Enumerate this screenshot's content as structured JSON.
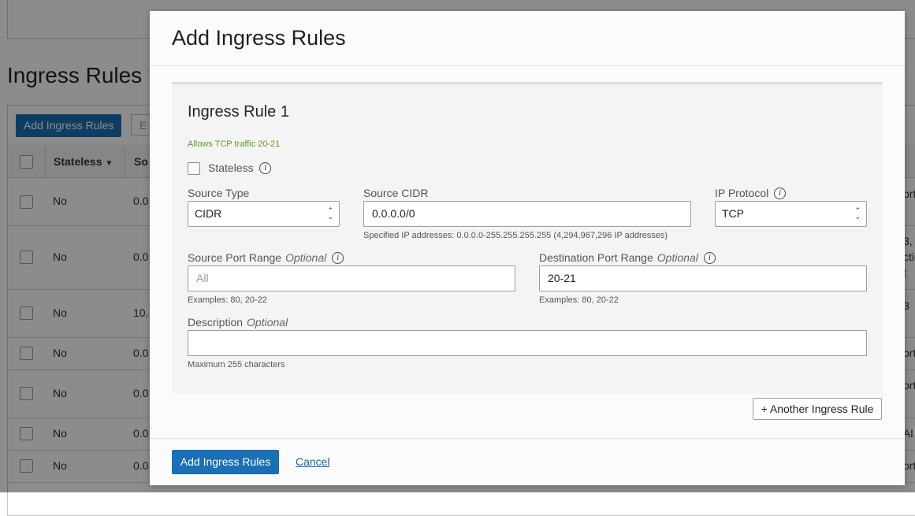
{
  "background": {
    "page_title": "Ingress Rules",
    "add_button": "Add Ingress Rules",
    "filter_placeholder": "E",
    "columns": {
      "stateless": "Stateless",
      "source": "So"
    },
    "rows": [
      {
        "stateless": "No",
        "source": "0.0",
        "right": "ort"
      },
      {
        "stateless": "No",
        "source": "0.0",
        "right": "3,"
      },
      {
        "stateless": "No",
        "source": "10.",
        "right": "3"
      },
      {
        "stateless": "No",
        "source": "0.0",
        "right": "ort"
      },
      {
        "stateless": "No",
        "source": "0.0",
        "right": "ort"
      },
      {
        "stateless": "No",
        "source": "0.0",
        "right": "Al"
      },
      {
        "stateless": "No",
        "source": "0.0",
        "right": "ort"
      }
    ],
    "row2_extra": [
      "ctic",
      "t"
    ]
  },
  "modal": {
    "title": "Add Ingress Rules",
    "rule": {
      "title": "Ingress Rule 1",
      "summary": "Allows TCP traffic 20-21",
      "stateless_label": "Stateless",
      "source_type": {
        "label": "Source Type",
        "value": "CIDR"
      },
      "source_cidr": {
        "label": "Source CIDR",
        "value": "0.0.0.0/0",
        "hint": "Specified IP addresses: 0.0.0.0-255.255.255.255 (4,294,967,296 IP addresses)"
      },
      "ip_protocol": {
        "label": "IP Protocol",
        "value": "TCP"
      },
      "source_port_range": {
        "label": "Source Port Range",
        "optional": "Optional",
        "placeholder": "All",
        "hint": "Examples: 80, 20-22"
      },
      "destination_port_range": {
        "label": "Destination Port Range",
        "optional": "Optional",
        "value": "20-21",
        "hint": "Examples: 80, 20-22"
      },
      "description": {
        "label": "Description",
        "optional": "Optional",
        "value": "",
        "hint": "Maximum 255 characters"
      }
    },
    "another_rule_button": "+ Another Ingress Rule",
    "footer": {
      "submit": "Add Ingress Rules",
      "cancel": "Cancel"
    }
  },
  "icons": {
    "info": "i",
    "select_arrows": "up-down-chevron"
  },
  "colors": {
    "primary": "#1a6fb5",
    "summary_green": "#5a9e20",
    "link": "#1a5fa8"
  }
}
